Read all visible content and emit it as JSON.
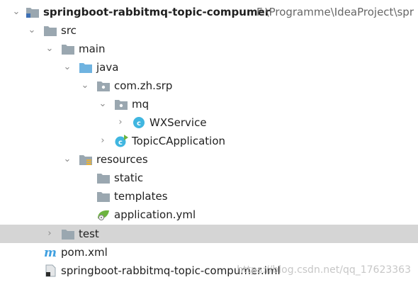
{
  "project_row": {
    "label": "springboot-rabbitmq-topic-compumer",
    "path": "F:\\Programme\\IdeaProject\\spr"
  },
  "rows": {
    "src": "src",
    "main": "main",
    "java": "java",
    "package": "com.zh.srp",
    "mq": "mq",
    "wxservice": "WXService",
    "topic_app": "TopicCApplication",
    "resources": "resources",
    "static": "static",
    "templates": "templates",
    "application_yml": "application.yml",
    "test": "test",
    "pom": "pom.xml",
    "iml": "springboot-rabbitmq-topic-compumer.iml"
  },
  "watermark": "https://blog.csdn.net/qq_17623363",
  "colors": {
    "folder": "#9aa7b0",
    "source_folder": "#6fb3e0",
    "class_icon": "#40b6e0",
    "selected_row": "#d5d5d5",
    "spring_leaf": "#6db33f"
  }
}
